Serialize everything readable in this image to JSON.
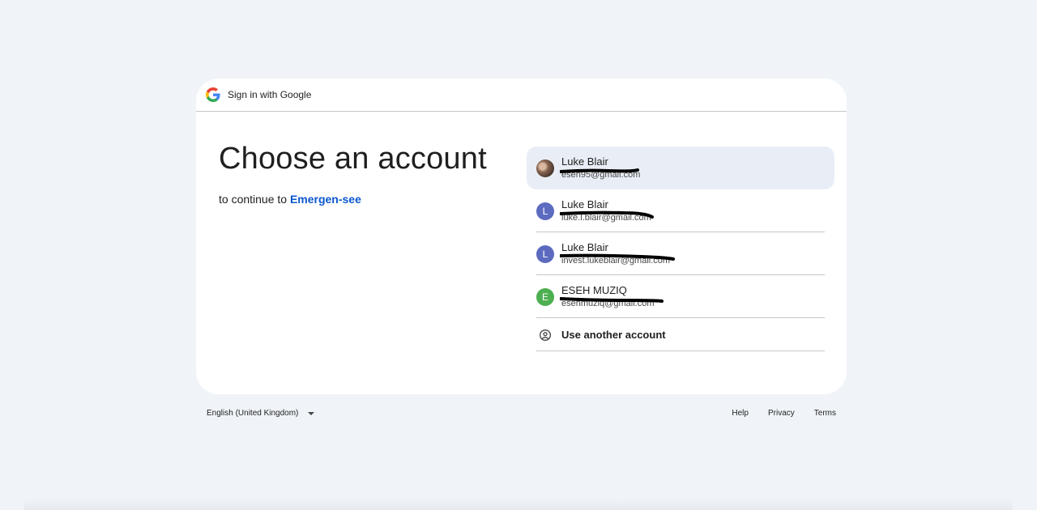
{
  "header": {
    "title": "Sign in with Google",
    "logo_icon": "google-g-icon"
  },
  "main": {
    "heading": "Choose an account",
    "subtitle_prefix": "to continue to",
    "app_name": "Emergen-see"
  },
  "accounts": [
    {
      "name": "Luke Blair",
      "email": "eseh95@gmail.com",
      "avatar_letter": "",
      "avatar_color": "",
      "selected": true
    },
    {
      "name": "Luke Blair",
      "email": "luke.l.blair@gmail.com",
      "avatar_letter": "L",
      "avatar_color": "#5c6bc0",
      "selected": false
    },
    {
      "name": "Luke Blair",
      "email": "invest.lukeblair@gmail.com",
      "avatar_letter": "L",
      "avatar_color": "#5c6bc0",
      "selected": false
    },
    {
      "name": "ESEH MUZIQ",
      "email": "esehmuziq@gmail.com",
      "avatar_letter": "E",
      "avatar_color": "#4caf50",
      "selected": false
    }
  ],
  "another_account": {
    "label": "Use another account",
    "icon": "account-circle-icon"
  },
  "footer": {
    "language": "English (United Kingdom)",
    "help": "Help",
    "privacy": "Privacy",
    "terms": "Terms"
  },
  "colors": {
    "page_bg": "#f0f4f9",
    "accent": "#0b57d0",
    "selected_bg": "#e9eef6"
  }
}
